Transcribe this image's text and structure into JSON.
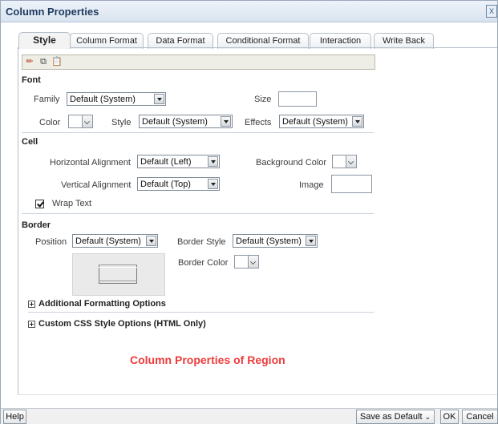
{
  "dialog": {
    "title": "Column Properties",
    "close_glyph": "X"
  },
  "tabs": [
    {
      "label": "Style",
      "active": true
    },
    {
      "label": "Column Format",
      "active": false
    },
    {
      "label": "Data Format",
      "active": false
    },
    {
      "label": "Conditional Format",
      "active": false
    },
    {
      "label": "Interaction",
      "active": false
    },
    {
      "label": "Write Back",
      "active": false
    }
  ],
  "toolbar": {
    "icons": [
      "clear-format-icon",
      "copy-icon",
      "paste-icon"
    ]
  },
  "font": {
    "heading": "Font",
    "family_label": "Family",
    "family_value": "Default (System)",
    "size_label": "Size",
    "size_value": "",
    "color_label": "Color",
    "style_label": "Style",
    "style_value": "Default (System)",
    "effects_label": "Effects",
    "effects_value": "Default (System)"
  },
  "cell": {
    "heading": "Cell",
    "halign_label": "Horizontal Alignment",
    "halign_value": "Default (Left)",
    "bgcolor_label": "Background Color",
    "valign_label": "Vertical Alignment",
    "valign_value": "Default (Top)",
    "image_label": "Image",
    "wrap_label": "Wrap Text",
    "wrap_checked": true
  },
  "border": {
    "heading": "Border",
    "position_label": "Position",
    "position_value": "Default (System)",
    "style_label": "Border Style",
    "style_value": "Default (System)",
    "color_label": "Border Color"
  },
  "expanders": [
    "Additional Formatting Options",
    "Custom CSS Style Options (HTML Only)"
  ],
  "caption": "Column Properties of Region",
  "footer": {
    "help": "Help",
    "save_default": "Save as Default",
    "ok": "OK",
    "cancel": "Cancel"
  },
  "colors": {
    "caption": "#ee3a3a",
    "title": "#1e3a5f"
  }
}
